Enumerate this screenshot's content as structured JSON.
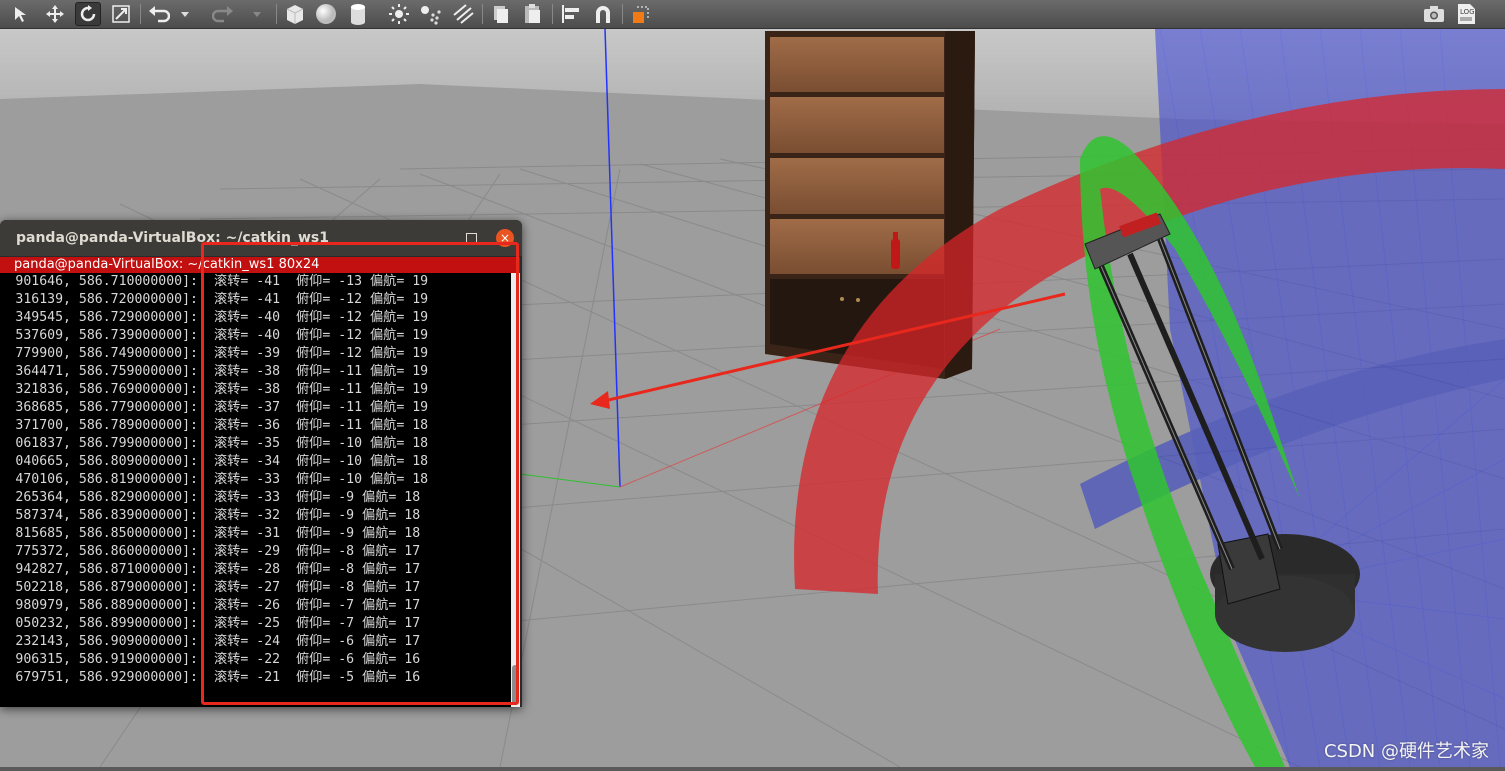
{
  "toolbar": {
    "tools": [
      "select-arrow-icon",
      "translate-icon",
      "rotate-icon",
      "scale-icon",
      "undo-icon",
      "undo-dropdown-icon",
      "redo-icon",
      "redo-dropdown-icon",
      "box-shape-icon",
      "sphere-shape-icon",
      "cylinder-shape-icon",
      "point-light-icon",
      "spot-light-icon",
      "directional-light-icon",
      "copy-icon",
      "paste-icon",
      "align-icon",
      "magnet-icon",
      "color-change-icon",
      "screenshot-icon",
      "log-icon"
    ],
    "log_label": "LOG"
  },
  "terminal": {
    "window_title": "panda@panda-VirtualBox: ~/catkin_ws1",
    "tab_title": "panda@panda-VirtualBox: ~/catkin_ws1 80x24",
    "close_glyph": "×",
    "minimize_glyph": "_",
    "lines": [
      {
        "left": "901646, 586.710000000]:",
        "right": "滚转= -41  俯仰= -13 偏航= 19"
      },
      {
        "left": "316139, 586.720000000]:",
        "right": "滚转= -41  俯仰= -12 偏航= 19"
      },
      {
        "left": "349545, 586.729000000]:",
        "right": "滚转= -40  俯仰= -12 偏航= 19"
      },
      {
        "left": "537609, 586.739000000]:",
        "right": "滚转= -40  俯仰= -12 偏航= 19"
      },
      {
        "left": "779900, 586.749000000]:",
        "right": "滚转= -39  俯仰= -12 偏航= 19"
      },
      {
        "left": "364471, 586.759000000]:",
        "right": "滚转= -38  俯仰= -11 偏航= 19"
      },
      {
        "left": "321836, 586.769000000]:",
        "right": "滚转= -38  俯仰= -11 偏航= 19"
      },
      {
        "left": "368685, 586.779000000]:",
        "right": "滚转= -37  俯仰= -11 偏航= 19"
      },
      {
        "left": "371700, 586.789000000]:",
        "right": "滚转= -36  俯仰= -11 偏航= 18"
      },
      {
        "left": "061837, 586.799000000]:",
        "right": "滚转= -35  俯仰= -10 偏航= 18"
      },
      {
        "left": "040665, 586.809000000]:",
        "right": "滚转= -34  俯仰= -10 偏航= 18"
      },
      {
        "left": "470106, 586.819000000]:",
        "right": "滚转= -33  俯仰= -10 偏航= 18"
      },
      {
        "left": "265364, 586.829000000]:",
        "right": "滚转= -33  俯仰= -9 偏航= 18"
      },
      {
        "left": "587374, 586.839000000]:",
        "right": "滚转= -32  俯仰= -9 偏航= 18"
      },
      {
        "left": "815685, 586.850000000]:",
        "right": "滚转= -31  俯仰= -9 偏航= 18"
      },
      {
        "left": "775372, 586.860000000]:",
        "right": "滚转= -29  俯仰= -8 偏航= 17"
      },
      {
        "left": "942827, 586.871000000]:",
        "right": "滚转= -28  俯仰= -8 偏航= 17"
      },
      {
        "left": "502218, 586.879000000]:",
        "right": "滚转= -27  俯仰= -8 偏航= 17"
      },
      {
        "left": "980979, 586.889000000]:",
        "right": "滚转= -26  俯仰= -7 偏航= 17"
      },
      {
        "left": "050232, 586.899000000]:",
        "right": "滚转= -25  俯仰= -7 偏航= 17"
      },
      {
        "left": "232143, 586.909000000]:",
        "right": "滚转= -24  俯仰= -6 偏航= 17"
      },
      {
        "left": "906315, 586.919000000]:",
        "right": "滚转= -22  俯仰= -6 偏航= 16"
      },
      {
        "left": "679751, 586.929000000]:",
        "right": "滚转= -21  俯仰= -5 偏航= 16"
      }
    ]
  },
  "watermark": "CSDN @硬件艺术家",
  "colors": {
    "roll_ring": "#d8252a",
    "pitch_ring": "#2fc42f",
    "yaw_ring": "#2630c8",
    "highlight": "#e8281c",
    "terminal_tab": "#c21010"
  }
}
